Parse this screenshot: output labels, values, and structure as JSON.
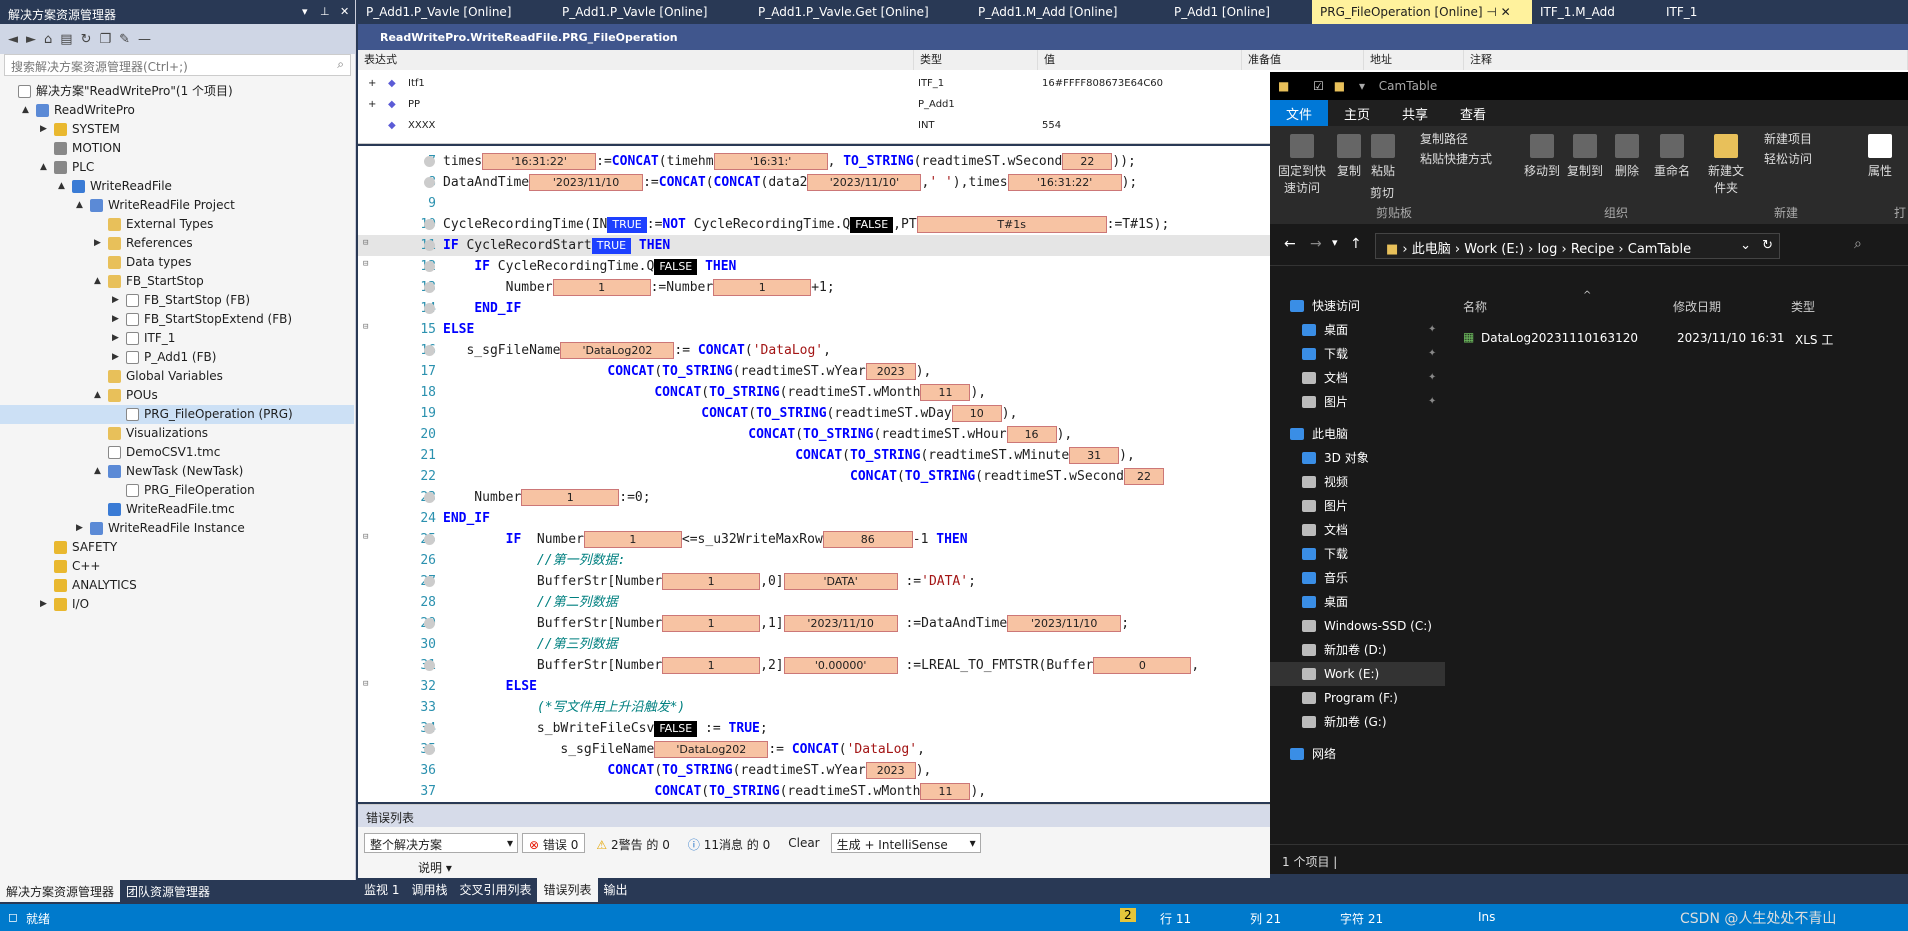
{
  "solution_explorer": {
    "title": "解决方案资源管理器",
    "search_placeholder": "搜索解决方案资源管理器(Ctrl+;)",
    "tree": [
      {
        "label": "解决方案\"ReadWritePro\"(1 个项目)",
        "level": 0,
        "icon": "solution-icon",
        "arrow": ""
      },
      {
        "label": "ReadWritePro",
        "level": 1,
        "icon": "project-icon",
        "arrow": "▲"
      },
      {
        "label": "SYSTEM",
        "level": 2,
        "icon": "system-icon",
        "arrow": "▶"
      },
      {
        "label": "MOTION",
        "level": 2,
        "icon": "motion-icon",
        "arrow": ""
      },
      {
        "label": "PLC",
        "level": 2,
        "icon": "plc-icon",
        "arrow": "▲"
      },
      {
        "label": "WriteReadFile",
        "level": 3,
        "icon": "plc-project-icon",
        "arrow": "▲"
      },
      {
        "label": "WriteReadFile Project",
        "level": 4,
        "icon": "project-icon",
        "arrow": "▲"
      },
      {
        "label": "External Types",
        "level": 5,
        "icon": "folder-icon",
        "arrow": ""
      },
      {
        "label": "References",
        "level": 5,
        "icon": "folder-icon",
        "arrow": "▶"
      },
      {
        "label": "Data types",
        "level": 5,
        "icon": "folder-icon",
        "arrow": ""
      },
      {
        "label": "FB_StartStop",
        "level": 5,
        "icon": "folder-icon",
        "arrow": "▲"
      },
      {
        "label": "FB_StartStop (FB)",
        "level": 6,
        "icon": "file-icon",
        "arrow": "▶"
      },
      {
        "label": "FB_StartStopExtend (FB)",
        "level": 6,
        "icon": "file-icon",
        "arrow": "▶"
      },
      {
        "label": "ITF_1",
        "level": 6,
        "icon": "interface-icon",
        "arrow": "▶"
      },
      {
        "label": "P_Add1 (FB)",
        "level": 6,
        "icon": "file-icon",
        "arrow": "▶"
      },
      {
        "label": "Global Variables",
        "level": 5,
        "icon": "folder-icon",
        "arrow": ""
      },
      {
        "label": "POUs",
        "level": 5,
        "icon": "folder-icon",
        "arrow": "▲"
      },
      {
        "label": "PRG_FileOperation (PRG)",
        "level": 6,
        "icon": "file-icon",
        "arrow": "",
        "selected": true
      },
      {
        "label": "Visualizations",
        "level": 5,
        "icon": "folder-icon",
        "arrow": ""
      },
      {
        "label": "DemoCSV1.tmc",
        "level": 5,
        "icon": "file-icon",
        "arrow": ""
      },
      {
        "label": "NewTask (NewTask)",
        "level": 5,
        "icon": "task-icon",
        "arrow": "▲"
      },
      {
        "label": "PRG_FileOperation",
        "level": 6,
        "icon": "file-icon",
        "arrow": ""
      },
      {
        "label": "WriteReadFile.tmc",
        "level": 5,
        "icon": "tmc-icon",
        "arrow": ""
      },
      {
        "label": "WriteReadFile Instance",
        "level": 4,
        "icon": "instance-icon",
        "arrow": "▶"
      },
      {
        "label": "SAFETY",
        "level": 2,
        "icon": "safety-icon",
        "arrow": ""
      },
      {
        "label": "C++",
        "level": 2,
        "icon": "cpp-icon",
        "arrow": ""
      },
      {
        "label": "ANALYTICS",
        "level": 2,
        "icon": "analytics-icon",
        "arrow": ""
      },
      {
        "label": "I/O",
        "level": 2,
        "icon": "io-icon",
        "arrow": "▶"
      }
    ],
    "bottom_tabs": [
      "解决方案资源管理器",
      "团队资源管理器"
    ]
  },
  "editor_tabs": [
    {
      "label": "P_Add1.P_Vavle [Online]",
      "active": false
    },
    {
      "label": "P_Add1.P_Vavle [Online]",
      "active": false
    },
    {
      "label": "P_Add1.P_Vavle.Get [Online]",
      "active": false
    },
    {
      "label": "P_Add1.M_Add [Online]",
      "active": false
    },
    {
      "label": "P_Add1 [Online]",
      "active": false
    },
    {
      "label": "PRG_FileOperation [Online]",
      "active": true
    },
    {
      "label": "ITF_1.M_Add",
      "active": false
    },
    {
      "label": "ITF_1",
      "active": false
    }
  ],
  "editor_header": "ReadWritePro.WriteReadFile.PRG_FileOperation",
  "watch": {
    "columns": [
      "表达式",
      "类型",
      "值",
      "准备值",
      "地址",
      "注释"
    ],
    "rows": [
      {
        "expr": "Itf1",
        "type": "ITF_1",
        "value": "16#FFFF808673E64C60"
      },
      {
        "expr": "PP",
        "type": "P_Add1",
        "value": ""
      },
      {
        "expr": "XXXX",
        "type": "INT",
        "value": "554"
      }
    ]
  },
  "code": {
    "lines": [
      7,
      8,
      9,
      10,
      11,
      12,
      13,
      14,
      15,
      16,
      17,
      18,
      19,
      20,
      21,
      22,
      23,
      24,
      25,
      26,
      27,
      28,
      29,
      30,
      31,
      32,
      33,
      34,
      35,
      36,
      37
    ],
    "online_values": {
      "times": "'16:31:22'",
      "timehm": "'16:31:'",
      "wSecond": "22",
      "DataAndTime": "'2023/11/10",
      "data2": "'2023/11/10'",
      "times2": "'16:31:22'",
      "PT": "T#1s",
      "Number": "1",
      "sgFileName": "'DataLog202",
      "wYear": "2023",
      "wMonth": "11",
      "wDay": "10",
      "wHour": "16",
      "wMinute": "31",
      "MaxRow": "86",
      "DATA": "'DATA'",
      "Date2": "'2023/11/10",
      "Zero": "'0.00000'",
      "Buffer0": "0",
      "TRUE": "TRUE",
      "FALSE": "FALSE"
    },
    "comment1": "//第一列数据:",
    "comment2": "//第二列数据",
    "comment3": "//第三列数据",
    "comment4": "(*写文件用上升沿触发*)"
  },
  "error_list": {
    "title": "错误列表",
    "scope": "整个解决方案",
    "errors": "错误 0",
    "warnings": "2警告 的 0",
    "messages": "11消息 的 0",
    "clear": "Clear",
    "build": "生成 + IntelliSense",
    "col_desc": "说明"
  },
  "bottom_tabs": [
    "监视 1",
    "调用栈",
    "交叉引用列表",
    "错误列表",
    "输出"
  ],
  "status": {
    "ready": "就绪",
    "num": "2",
    "line": "行 11",
    "col": "列 21",
    "char": "字符 21",
    "ins": "Ins",
    "watermark": "CSDN @人生处处不青山"
  },
  "file_explorer": {
    "title": "CamTable",
    "menu": [
      "文件",
      "主页",
      "共享",
      "查看"
    ],
    "ribbon": {
      "pin": "固定到快速访问",
      "copy": "复制",
      "paste": "粘贴",
      "copy_path": "复制路径",
      "paste_shortcut": "粘贴快捷方式",
      "cut": "剪切",
      "clipboard": "剪贴板",
      "move_to": "移动到",
      "copy_to": "复制到",
      "delete": "删除",
      "rename": "重命名",
      "organize": "组织",
      "new_folder": "新建文件夹",
      "new_item": "新建项目",
      "easy_access": "轻松访问",
      "new": "新建",
      "properties": "属性",
      "open": "打"
    },
    "breadcrumb": [
      "此电脑",
      "Work (E:)",
      "log",
      "Recipe",
      "CamTable"
    ],
    "nav": [
      {
        "label": "快速访问",
        "icon": "star-icon",
        "pinned": false
      },
      {
        "label": "桌面",
        "icon": "desktop-icon",
        "pinned": true
      },
      {
        "label": "下载",
        "icon": "download-icon",
        "pinned": true
      },
      {
        "label": "文档",
        "icon": "document-icon",
        "pinned": true
      },
      {
        "label": "图片",
        "icon": "picture-icon",
        "pinned": true
      },
      {
        "label": "此电脑",
        "icon": "pc-icon",
        "pinned": false
      },
      {
        "label": "3D 对象",
        "icon": "3d-icon",
        "pinned": false
      },
      {
        "label": "视频",
        "icon": "video-icon",
        "pinned": false
      },
      {
        "label": "图片",
        "icon": "picture-icon",
        "pinned": false
      },
      {
        "label": "文档",
        "icon": "document-icon",
        "pinned": false
      },
      {
        "label": "下载",
        "icon": "download-icon",
        "pinned": false
      },
      {
        "label": "音乐",
        "icon": "music-icon",
        "pinned": false
      },
      {
        "label": "桌面",
        "icon": "desktop-icon",
        "pinned": false
      },
      {
        "label": "Windows-SSD (C:)",
        "icon": "drive-icon",
        "pinned": false
      },
      {
        "label": "新加卷 (D:)",
        "icon": "drive-icon",
        "pinned": false
      },
      {
        "label": "Work (E:)",
        "icon": "drive-icon",
        "pinned": false,
        "selected": true
      },
      {
        "label": "Program (F:)",
        "icon": "drive-icon",
        "pinned": false
      },
      {
        "label": "新加卷 (G:)",
        "icon": "drive-icon",
        "pinned": false
      },
      {
        "label": "网络",
        "icon": "network-icon",
        "pinned": false
      }
    ],
    "columns": [
      "名称",
      "修改日期",
      "类型"
    ],
    "files": [
      {
        "name": "DataLog20231110163120",
        "date": "2023/11/10 16:31",
        "type": "XLS 工"
      }
    ],
    "footer": "1 个项目"
  }
}
